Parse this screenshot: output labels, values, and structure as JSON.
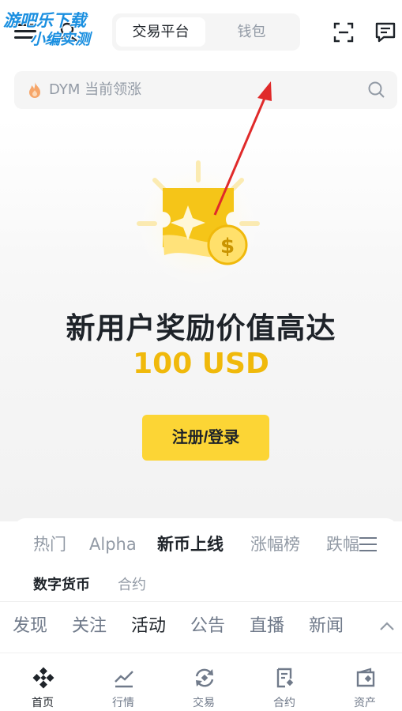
{
  "watermark": {
    "line1": "游吧乐下载",
    "line2": "小编实测"
  },
  "header": {
    "tabs": [
      {
        "label": "交易平台",
        "active": true
      },
      {
        "label": "钱包",
        "active": false
      }
    ],
    "icons": [
      "menu-icon",
      "avatar-icon",
      "scan-icon",
      "message-icon"
    ]
  },
  "search": {
    "placeholder": "DYM 当前领涨",
    "icon": "fire-icon"
  },
  "promo": {
    "title": "新用户奖励价值高达",
    "amount": "100 USD",
    "cta_label": "注册/登录",
    "accent": "#f0b90b",
    "button_color": "#fcd535"
  },
  "market": {
    "tabs": [
      "热门",
      "Alpha",
      "新币上线",
      "涨幅榜",
      "跌幅"
    ],
    "active_tab": "新币上线",
    "subtabs": [
      "数字货币",
      "合约"
    ],
    "active_subtab": "数字货币"
  },
  "feed": {
    "tabs": [
      "发现",
      "关注",
      "活动",
      "公告",
      "直播",
      "新闻"
    ],
    "active_tab": "活动"
  },
  "bottom_nav": [
    {
      "label": "首页",
      "icon": "binance-logo-icon",
      "active": true
    },
    {
      "label": "行情",
      "icon": "chart-icon",
      "active": false
    },
    {
      "label": "交易",
      "icon": "trade-icon",
      "active": false
    },
    {
      "label": "合约",
      "icon": "futures-icon",
      "active": false
    },
    {
      "label": "资产",
      "icon": "wallet-icon",
      "active": false
    }
  ]
}
